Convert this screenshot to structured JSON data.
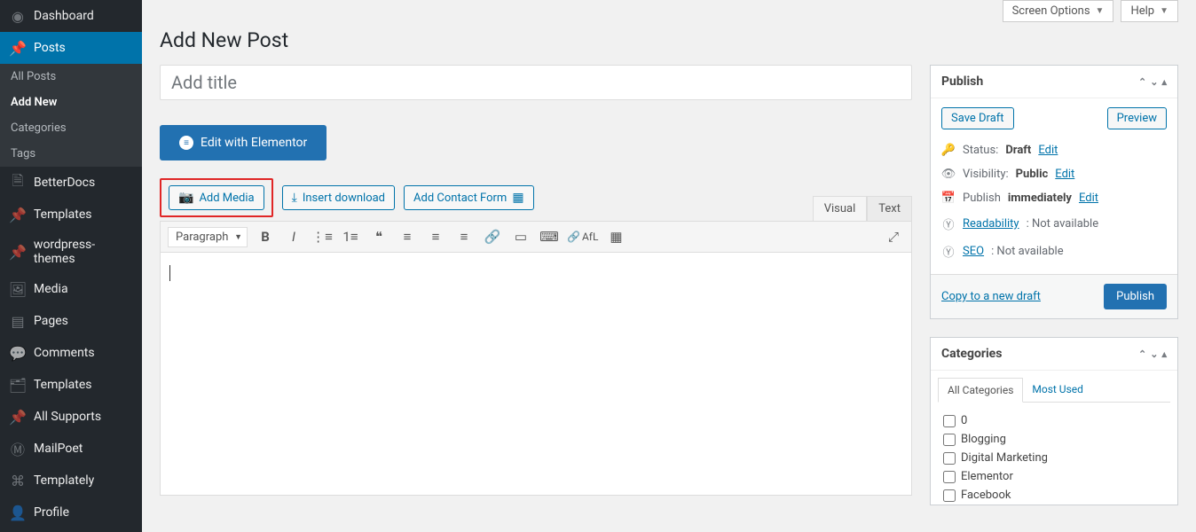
{
  "top": {
    "screen_options": "Screen Options",
    "help": "Help"
  },
  "page_title": "Add New Post",
  "title_placeholder": "Add title",
  "elementor_label": "Edit with Elementor",
  "buttons": {
    "add_media": "Add Media",
    "insert_download": "Insert download",
    "add_contact_form": "Add Contact Form"
  },
  "editor_tabs": {
    "visual": "Visual",
    "text": "Text"
  },
  "format_selected": "Paragraph",
  "afl_label": "AfL",
  "sidebar": {
    "dashboard": "Dashboard",
    "posts": "Posts",
    "posts_sub": {
      "all": "All Posts",
      "add_new": "Add New",
      "categories": "Categories",
      "tags": "Tags"
    },
    "betterdocs": "BetterDocs",
    "templates": "Templates",
    "wp_themes": "wordpress-themes",
    "media": "Media",
    "pages": "Pages",
    "comments": "Comments",
    "templates2": "Templates",
    "all_supports": "All Supports",
    "mailpoet": "MailPoet",
    "templately": "Templately",
    "profile": "Profile"
  },
  "publish": {
    "title": "Publish",
    "save_draft": "Save Draft",
    "preview": "Preview",
    "status_label": "Status:",
    "status_value": "Draft",
    "status_edit": "Edit",
    "visibility_label": "Visibility:",
    "visibility_value": "Public",
    "visibility_edit": "Edit",
    "publish_label": "Publish",
    "publish_value": "immediately",
    "publish_edit": "Edit",
    "readability_label": "Readability",
    "readability_value": ": Not available",
    "seo_label": "SEO",
    "seo_value": ": Not available",
    "copy_link": "Copy to a new draft",
    "publish_btn": "Publish"
  },
  "categories": {
    "title": "Categories",
    "tab_all": "All Categories",
    "tab_most": "Most Used",
    "items": [
      "0",
      "Blogging",
      "Digital Marketing",
      "Elementor",
      "Facebook"
    ]
  }
}
